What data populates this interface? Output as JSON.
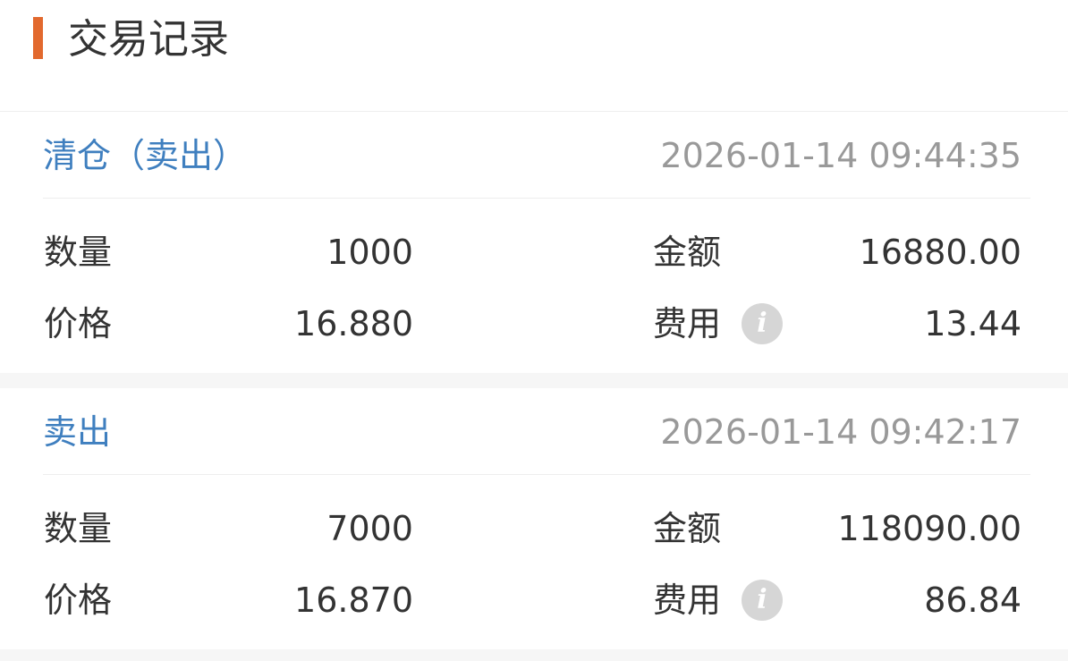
{
  "header": {
    "title": "交易记录",
    "accent_color": "#e2692e"
  },
  "colors": {
    "type_text": "#3f7fbf",
    "time_text": "#999999",
    "body_text": "#333333",
    "info_icon_bg": "#d6d6d6"
  },
  "records": [
    {
      "type": "清仓（卖出）",
      "time": "2026-01-14 09:44:35",
      "quantity_label": "数量",
      "quantity": "1000",
      "price_label": "价格",
      "price": "16.880",
      "amount_label": "金额",
      "amount": "16880.00",
      "fee_label": "费用",
      "fee_icon": "info-icon",
      "fee_icon_glyph": "i",
      "fee": "13.44"
    },
    {
      "type": "卖出",
      "time": "2026-01-14 09:42:17",
      "quantity_label": "数量",
      "quantity": "7000",
      "price_label": "价格",
      "price": "16.870",
      "amount_label": "金额",
      "amount": "118090.00",
      "fee_label": "费用",
      "fee_icon": "info-icon",
      "fee_icon_glyph": "i",
      "fee": "86.84"
    }
  ]
}
